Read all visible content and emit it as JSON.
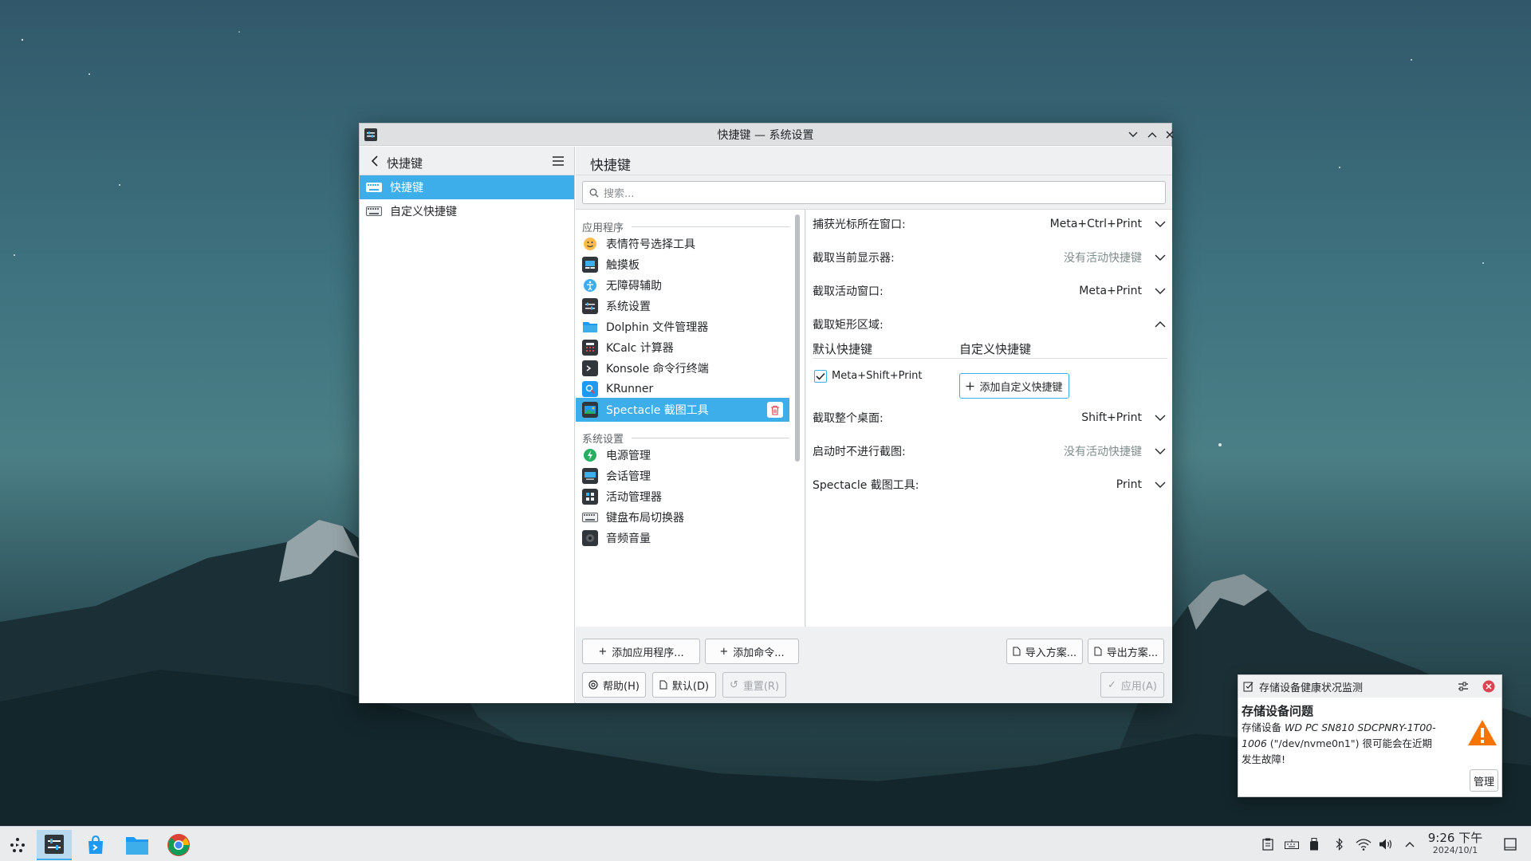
{
  "window": {
    "title": "快捷键 — 系统设置"
  },
  "sidebar": {
    "header": "快捷键",
    "items": [
      {
        "label": "快捷键",
        "active": true
      },
      {
        "label": "自定义快捷键",
        "active": false
      }
    ]
  },
  "main": {
    "title": "快捷键",
    "search_placeholder": "搜索...",
    "sections": [
      {
        "title": "应用程序",
        "items": [
          {
            "label": "表情符号选择工具",
            "icon": "emoji-icon"
          },
          {
            "label": "触摸板",
            "icon": "touchpad-icon"
          },
          {
            "label": "无障碍辅助",
            "icon": "accessibility-icon"
          },
          {
            "label": "系统设置",
            "icon": "system-settings-icon"
          },
          {
            "label": "Dolphin 文件管理器",
            "icon": "folder-icon"
          },
          {
            "label": "KCalc 计算器",
            "icon": "calculator-icon"
          },
          {
            "label": "Konsole 命令行终端",
            "icon": "terminal-icon"
          },
          {
            "label": "KRunner",
            "icon": "krunner-icon"
          },
          {
            "label": "Spectacle 截图工具",
            "icon": "spectacle-icon",
            "active": true
          }
        ]
      },
      {
        "title": "系统设置",
        "items": [
          {
            "label": "电源管理",
            "icon": "power-icon"
          },
          {
            "label": "会话管理",
            "icon": "session-icon"
          },
          {
            "label": "活动管理器",
            "icon": "activity-icon"
          },
          {
            "label": "键盘布局切换器",
            "icon": "keyboard-icon"
          },
          {
            "label": "音频音量",
            "icon": "audio-icon"
          }
        ]
      }
    ],
    "shortcuts": [
      {
        "name": "捕获光标所在窗口:",
        "value": "Meta+Ctrl+Print",
        "none": false
      },
      {
        "name": "截取当前显示器:",
        "value": "没有活动快捷键",
        "none": true
      },
      {
        "name": "截取活动窗口:",
        "value": "Meta+Print",
        "none": false
      },
      {
        "name": "截取矩形区域:",
        "value": "",
        "none": false,
        "expanded": true
      },
      {
        "name": "截取整个桌面:",
        "value": "Shift+Print",
        "none": false
      },
      {
        "name": "启动时不进行截图:",
        "value": "没有活动快捷键",
        "none": true
      },
      {
        "name": "Spectacle 截图工具:",
        "value": "Print",
        "none": false
      }
    ],
    "expanded": {
      "default_header": "默认快捷键",
      "custom_header": "自定义快捷键",
      "default_value": "Meta+Shift+Print",
      "add_custom_label": "添加自定义快捷键"
    },
    "buttons": {
      "add_app": "添加应用程序...",
      "add_command": "添加命令...",
      "import": "导入方案...",
      "export": "导出方案...",
      "help": "帮助(H)",
      "defaults": "默认(D)",
      "reset": "重置(R)",
      "apply": "应用(A)"
    }
  },
  "notification": {
    "app": "存储设备健康状况监测",
    "title": "存储设备问题",
    "body_prefix": "存储设备",
    "device": "WD PC SN810 SDCPNRY-1T00-1006",
    "body_suffix": "(\"/dev/nvme0n1\") 很可能会在近期发生故障!",
    "manage": "管理"
  },
  "taskbar": {
    "time": "9:26 下午",
    "date": "2024/10/1"
  },
  "colors": {
    "accent": "#3daee9",
    "warning": "#f67400",
    "close_red": "#da4453"
  }
}
